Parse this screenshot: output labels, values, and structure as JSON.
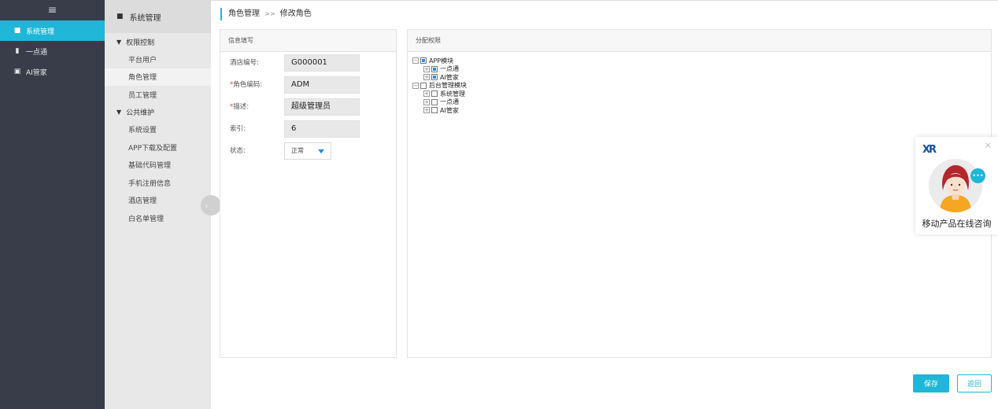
{
  "nav": {
    "toggle_glyph": "≡",
    "items": [
      {
        "label": "系统管理",
        "icon": "grid-icon",
        "glyph": "■",
        "active": true
      },
      {
        "label": "一点通",
        "icon": "bar-chart-icon",
        "glyph": "▮",
        "active": false
      },
      {
        "label": "AI管家",
        "icon": "lock-icon",
        "glyph": "▣",
        "active": false
      }
    ]
  },
  "submenu": {
    "title": "系统管理",
    "groups": [
      {
        "label": "权限控制",
        "items": [
          "平台用户",
          "角色管理",
          "员工管理"
        ]
      },
      {
        "label": "公共维护",
        "items": [
          "系统设置",
          "APP下载及配置",
          "基础代码管理",
          "手机注册信息",
          "酒店管理",
          "白名单管理"
        ]
      }
    ]
  },
  "breadcrumb": {
    "parent": "角色管理",
    "sep": ">>",
    "current": "修改角色"
  },
  "info_panel": {
    "title": "信息填写",
    "fields": [
      {
        "label": "酒店编号:",
        "required": false,
        "value": "G000001"
      },
      {
        "label": "角色编码:",
        "required": true,
        "value": "ADM"
      },
      {
        "label": "描述:",
        "required": true,
        "value": "超级管理员"
      },
      {
        "label": "索引:",
        "required": false,
        "value": "6"
      }
    ],
    "status": {
      "label": "状态:",
      "value": "正常"
    }
  },
  "perm_panel": {
    "title": "分配权限",
    "tree": [
      {
        "label": "APP模块",
        "checked": true,
        "children": [
          {
            "label": "一点通",
            "checked": true
          },
          {
            "label": "AI管家",
            "checked": true
          }
        ]
      },
      {
        "label": "后台管理模块",
        "checked": false,
        "children": [
          {
            "label": "系统管理",
            "checked": false
          },
          {
            "label": "一点通",
            "checked": false
          },
          {
            "label": "AI管家",
            "checked": false
          }
        ]
      }
    ]
  },
  "actions": {
    "save": "保存",
    "back": "返回"
  },
  "consult": {
    "logo": "XR",
    "close": "×",
    "text": "移动产品在线咨询",
    "bubble": "•••"
  },
  "colors": {
    "accent": "#1fb6d8",
    "nav_bg": "#393d49",
    "required": "#e53935"
  }
}
